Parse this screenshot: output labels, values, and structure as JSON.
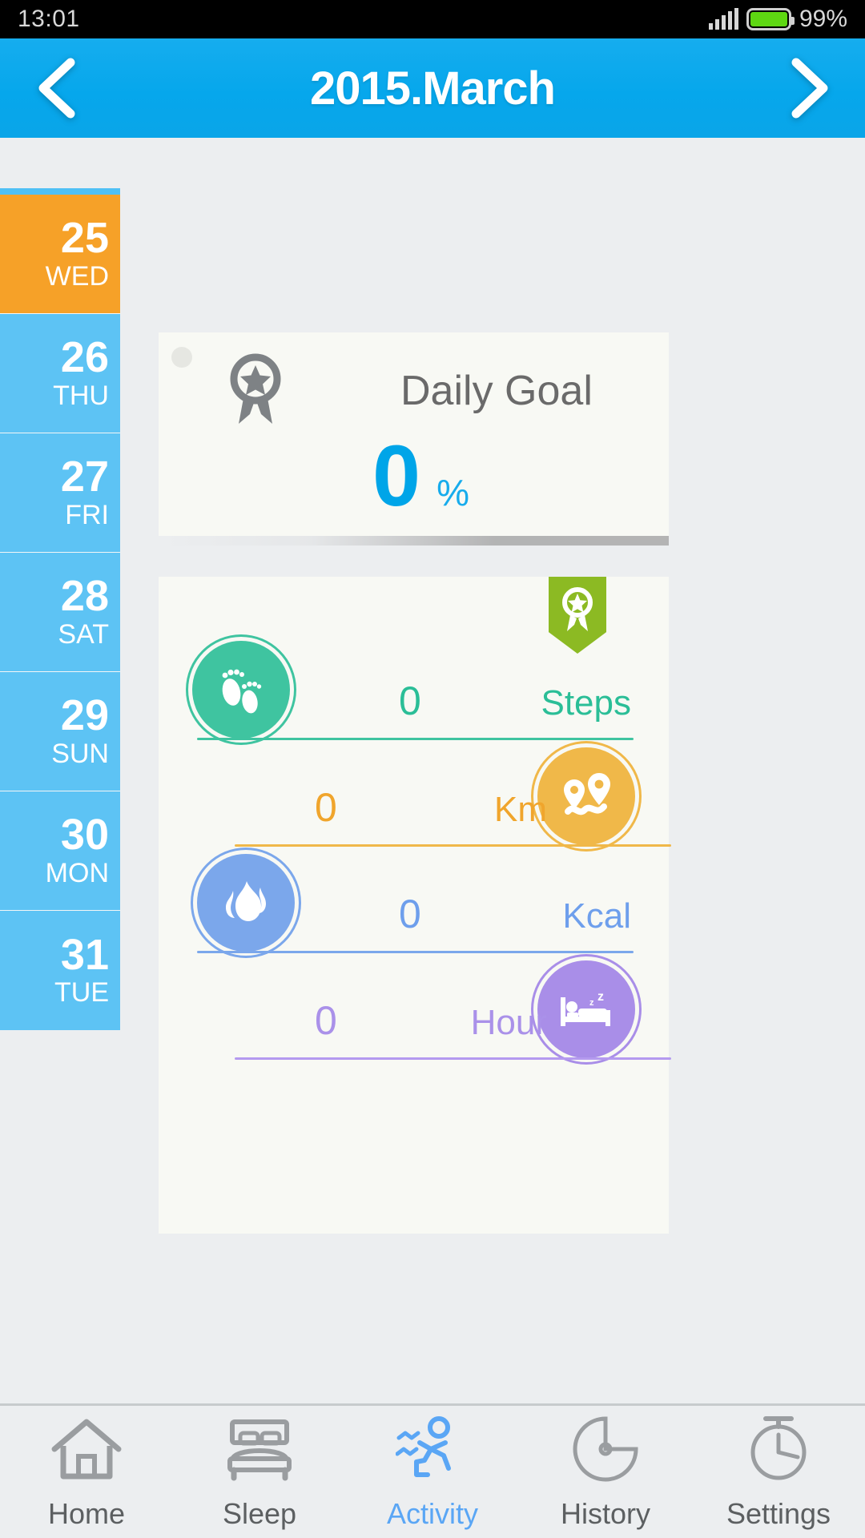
{
  "status_bar": {
    "time": "13:01",
    "battery_percent": "99%",
    "signal_icon": "signal-bars-icon",
    "battery_icon": "battery-icon",
    "battery_color": "#5ED712"
  },
  "header": {
    "title": "2015.March",
    "prev_icon": "chevron-left-icon",
    "next_icon": "chevron-right-icon",
    "background_color": "#0AA5E8"
  },
  "day_strip": {
    "selected_color": "#F6A128",
    "default_color": "#5DC3F4",
    "days": [
      {
        "num": "25",
        "weekday": "WED",
        "selected": true
      },
      {
        "num": "26",
        "weekday": "THU",
        "selected": false
      },
      {
        "num": "27",
        "weekday": "FRI",
        "selected": false
      },
      {
        "num": "28",
        "weekday": "SAT",
        "selected": false
      },
      {
        "num": "29",
        "weekday": "SUN",
        "selected": false
      },
      {
        "num": "30",
        "weekday": "MON",
        "selected": false
      },
      {
        "num": "31",
        "weekday": "TUE",
        "selected": false
      }
    ]
  },
  "daily_goal": {
    "title": "Daily Goal",
    "value": "0",
    "unit": "%",
    "medal_icon": "medal-star-icon",
    "value_color": "#00A5E8"
  },
  "metrics_card": {
    "ribbon_icon": "award-ribbon-icon",
    "ribbon_color": "#8CBA23",
    "metrics": [
      {
        "name": "steps",
        "value": "0",
        "unit": "Steps",
        "color": "#2BBE97",
        "icon": "footprints-icon",
        "icon_side": "left"
      },
      {
        "name": "distance",
        "value": "0",
        "unit": "Km",
        "color": "#F0A52C",
        "icon": "route-map-pins-icon",
        "icon_side": "right"
      },
      {
        "name": "calories",
        "value": "0",
        "unit": "Kcal",
        "color": "#6E9FEC",
        "icon": "flame-icon",
        "icon_side": "left"
      },
      {
        "name": "sleep",
        "value": "0",
        "unit": "Hour",
        "color": "#AA91E9",
        "icon": "bed-sleep-icon",
        "icon_side": "right"
      }
    ]
  },
  "tab_bar": {
    "active_color": "#5AA6F5",
    "inactive_color": "#5C5F61",
    "tabs": [
      {
        "label": "Home",
        "icon": "house-icon",
        "active": false
      },
      {
        "label": "Sleep",
        "icon": "bed-icon",
        "active": false
      },
      {
        "label": "Activity",
        "icon": "running-icon",
        "active": true
      },
      {
        "label": "History",
        "icon": "pie-clock-icon",
        "active": false
      },
      {
        "label": "Settings",
        "icon": "stopwatch-icon",
        "active": false
      }
    ]
  }
}
